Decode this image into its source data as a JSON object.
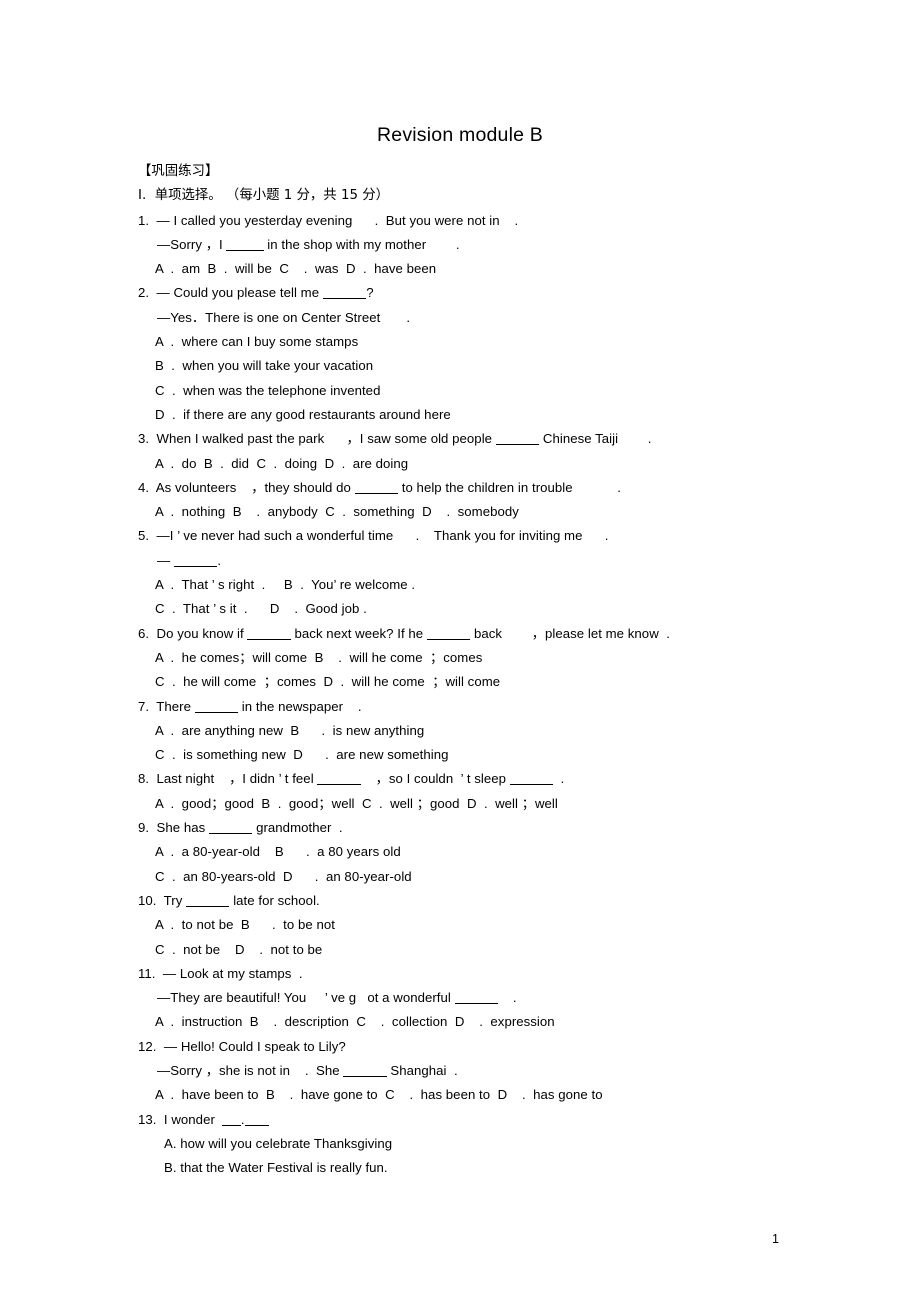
{
  "document": {
    "title": "Revision module B",
    "section_header": "【巩固练习】",
    "section_instruction": "I.  单项选择。 （每小题 1 分，共 15 分）",
    "page_number": "1"
  },
  "questions": [
    {
      "number": "1.",
      "lines": [
        {
          "indent": "q",
          "text": "1.  — I called you yesterday evening      .  But you were not in    ."
        },
        {
          "indent": "sub",
          "text": "—Sorry ，I ______ in the shop with my mother        ."
        },
        {
          "indent": "opt",
          "text": "A  .  am  B  .  will be  C    .  was  D  .  have been"
        }
      ]
    },
    {
      "number": "2.",
      "lines": [
        {
          "indent": "q",
          "text": "2.  — Could you please tell me _______?"
        },
        {
          "indent": "sub",
          "text": "—Yes．There is one on Center Street       ."
        },
        {
          "indent": "opt",
          "text": "A  .  where can I buy some stamps"
        },
        {
          "indent": "opt",
          "text": "B  .  when you will take your vacation"
        },
        {
          "indent": "opt",
          "text": "C  .  when was the telephone invented"
        },
        {
          "indent": "opt",
          "text": "D  .  if there are any good restaurants around here"
        }
      ]
    },
    {
      "number": "3.",
      "lines": [
        {
          "indent": "q",
          "text": "3.  When I walked past the park      ，I saw some old people _______ Chinese Taiji        ."
        },
        {
          "indent": "opt",
          "text": "A  .  do  B  .  did  C  .  doing  D  .  are doing"
        }
      ]
    },
    {
      "number": "4.",
      "lines": [
        {
          "indent": "q",
          "text": "4.  As volunteers    ，they should do _______ to help the children in trouble            ."
        },
        {
          "indent": "opt",
          "text": "A  .  nothing  B    .  anybody  C  .  something  D    .  somebody"
        }
      ]
    },
    {
      "number": "5.",
      "lines": [
        {
          "indent": "q",
          "text": "5.  —I ’ ve never had such a wonderful time      .    Thank you for inviting me      ."
        },
        {
          "indent": "sub",
          "text": "— _______."
        },
        {
          "indent": "opt",
          "text": "A  .  That ’ s right  .     B  .  You’ re welcome ."
        },
        {
          "indent": "opt",
          "text": "C  .  That ’ s it  .      D    .  Good job ."
        }
      ]
    },
    {
      "number": "6.",
      "lines": [
        {
          "indent": "q",
          "text": "6.  Do you know if _______ back next week? If he _______ back        ，please let me know  ."
        },
        {
          "indent": "opt",
          "text": "A  .  he comes；will come  B    .  will he come  ；comes"
        },
        {
          "indent": "opt",
          "text": "C  .  he will come  ；comes  D  .  will he come  ；will come"
        }
      ]
    },
    {
      "number": "7.",
      "lines": [
        {
          "indent": "q",
          "text": "7.  There _______ in the newspaper    ."
        },
        {
          "indent": "opt",
          "text": "A  .  are anything new  B      .  is new anything"
        },
        {
          "indent": "opt",
          "text": "C  .  is something new  D      .  are new something"
        }
      ]
    },
    {
      "number": "8.",
      "lines": [
        {
          "indent": "q",
          "text": "8.  Last night    ，I didn ’ t feel _______    ，so I couldn  ’ t sleep _______  ."
        },
        {
          "indent": "opt",
          "text": "A  .  good；good  B  .  good；well  C  .  well ；good  D  .  well ；well"
        }
      ]
    },
    {
      "number": "9.",
      "lines": [
        {
          "indent": "q",
          "text": "9.  She has _______ grandmother  ."
        },
        {
          "indent": "opt",
          "text": "A  .  a 80-year-old    B      .  a 80 years old"
        },
        {
          "indent": "opt",
          "text": "C  .  an 80-years-old  D      .  an 80-year-old"
        }
      ]
    },
    {
      "number": "10.",
      "lines": [
        {
          "indent": "q",
          "text": "10.  Try _______ late for school."
        },
        {
          "indent": "opt",
          "text": "A  .  to not be  B      .  to be not"
        },
        {
          "indent": "opt",
          "text": "C  .  not be    D    .  not to be"
        }
      ]
    },
    {
      "number": "11.",
      "lines": [
        {
          "indent": "q",
          "text": "11.  — Look at my stamps  ."
        },
        {
          "indent": "sub",
          "text": "—They are beautiful! You     ’ ve g   ot a wonderful _______    ."
        },
        {
          "indent": "opt",
          "text": "A  .  instruction  B    .  description  C    .  collection  D    .  expression"
        }
      ]
    },
    {
      "number": "12.",
      "lines": [
        {
          "indent": "q",
          "text": "12.  — Hello! Could I speak to Lily?"
        },
        {
          "indent": "sub",
          "text": "—Sorry ，she is not in    .  She _______ Shanghai  ."
        },
        {
          "indent": "opt",
          "text": "A  .  have been to  B    .  have gone to  C    .  has been to  D    .  has gone to"
        }
      ]
    },
    {
      "number": "13.",
      "lines": [
        {
          "indent": "q",
          "text": "13.  I wonder  ___.____"
        },
        {
          "indent": "opt2",
          "text": "A. how will you celebrate Thanksgiving"
        },
        {
          "indent": "opt2",
          "text": "B. that the Water Festival is really fun."
        }
      ]
    }
  ]
}
